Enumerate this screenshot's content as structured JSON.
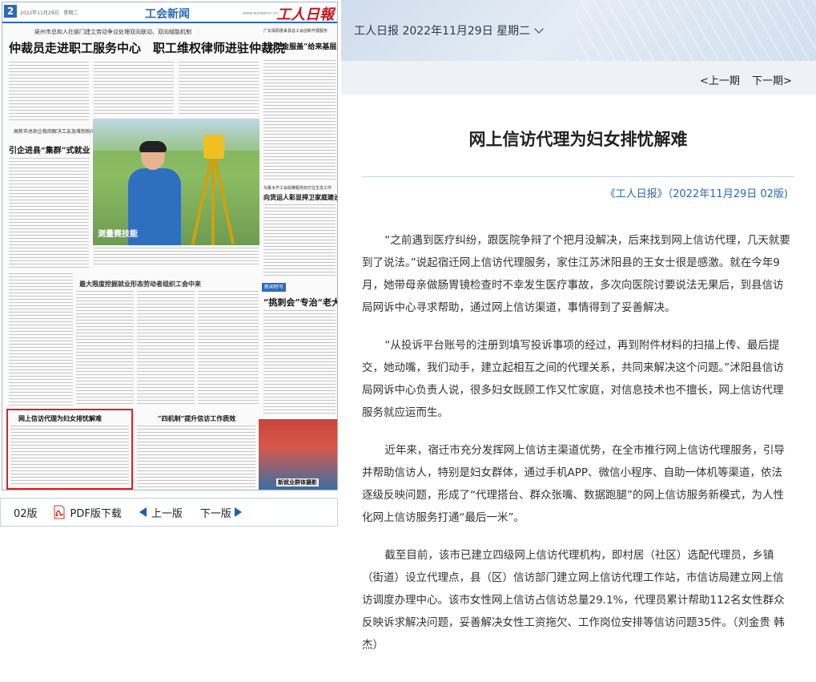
{
  "paper": {
    "page_number": "2",
    "date_line": "2022年11月29日　星期二",
    "section": "工会新闻",
    "masthead": "工人日報",
    "url": "www.workercn.cn",
    "headline_kicker": "泉州市总和人社部门建立劳动争议处理双向联动、双向赋能机制",
    "headline_main": "仲裁员走进职工服务中心　职工维权律师进驻仲裁院",
    "top_right_kicker": "广东揭阳惠来县总工会创新开展服务",
    "top_right_title": "“七个金服盖”给来基层工会赋能",
    "left_sub_kicker": "高新市总助企稳岗解决工友急难愁盼问题",
    "left_sub_title": "引企进县“集群”式就业",
    "photo_caption": "测量赛技能",
    "mid_kicker": "最大限度挖掘就业形态劳动者组织工会中来",
    "right_mid_kicker": "乌鲁木齐工会助推服务四方位生态工作",
    "right_mid_title": "向货运人彰显捍卫家庭建设新途",
    "badge": "新闻特写",
    "special_title": "“挑刺会”专治“老大难”",
    "highlight_title": "网上信访代理为妇女排忧解难",
    "bottom_mid_title": "“四机制”提升信访工作质效",
    "photo2_caption": "新就业群体摄影"
  },
  "nav_bar": {
    "page": "02版",
    "pdf": "PDF版下载",
    "prev": "上一版",
    "next": "下一版"
  },
  "header": {
    "date_select": "工人日报 2022年11月29日 星期二"
  },
  "issue_nav": {
    "prev": "<上一期",
    "next": "下一期>"
  },
  "article": {
    "title": "网上信访代理为妇女排忧解难",
    "source": "《工人日报》（2022年11月29日 02版)",
    "paragraphs": [
      "“之前遇到医疗纠纷，跟医院争辩了个把月没解决，后来找到网上信访代理，几天就要到了说法。”说起宿迁网上信访代理服务，家住江苏沭阳县的王女士很是感激。就在今年9月，她带母亲做肠胃镜检查时不幸发生医疗事故，多次向医院讨要说法无果后，到县信访局网诉中心寻求帮助，通过网上信访渠道，事情得到了妥善解决。",
      "“从投诉平台账号的注册到填写投诉事项的经过，再到附件材料的扫描上传、最后提交，她动嘴，我们动手，建立起相互之间的代理关系，共同来解决这个问题。”沭阳县信访局网诉中心负责人说，很多妇女既顾工作又忙家庭，对信息技术也不擅长，网上信访代理服务就应运而生。",
      "近年来，宿迁市充分发挥网上信访主渠道优势，在全市推行网上信访代理服务，引导并帮助信访人，特别是妇女群体，通过手机APP、微信小程序、自助一体机等渠道，依法逐级反映问题，形成了“代理搭台、群众张嘴、数据跑腿”的网上信访服务新模式，为人性化网上信访服务打通“最后一米”。",
      "截至目前，该市已建立四级网上信访代理机构，即村居（社区）选配代理员，乡镇（街道）设立代理点，县（区）信访部门建立网上信访代理工作站，市信访局建立网上信访调度办理中心。该市女性网上信访占信访总量29.1%，代理员累计帮助112名女性群众反映诉求解决问题，妥善解决女性工资拖欠、工作岗位安排等信访问题35件。（刘金贵 韩杰）"
    ]
  },
  "colors": {
    "accent_blue": "#2a6ab8",
    "source_blue": "#2a66b0",
    "masthead_red": "#c8161d",
    "highlight_red": "#e02020"
  },
  "icons": {
    "pdf": "pdf-icon",
    "prev": "triangle-left-icon",
    "next": "triangle-right-icon",
    "dropdown": "chevron-down-icon"
  }
}
